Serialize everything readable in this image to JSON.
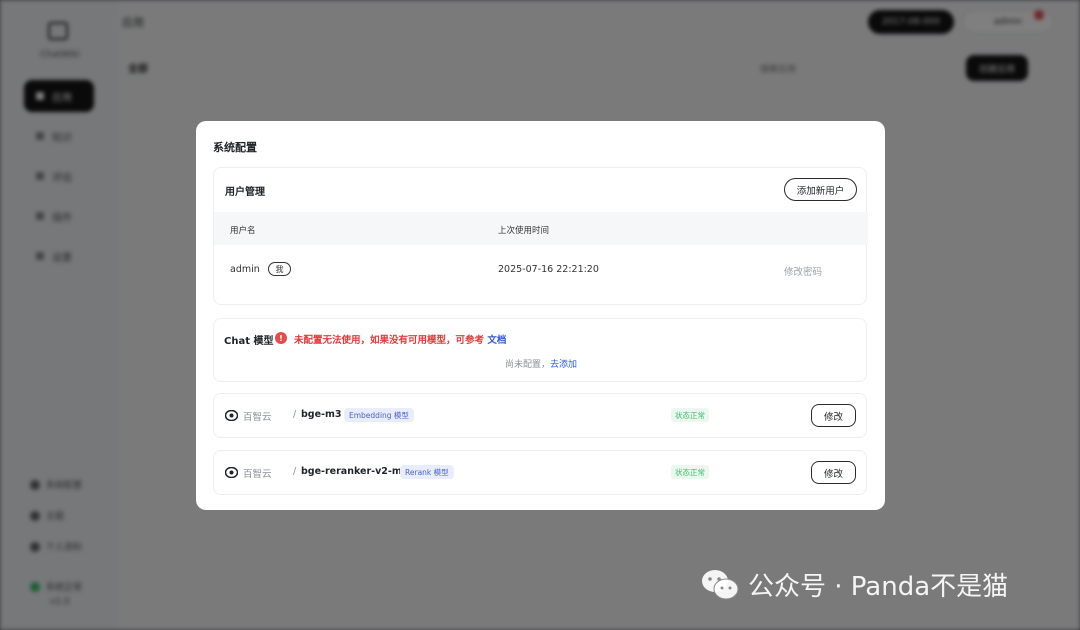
{
  "background": {
    "sidebar": {
      "brand": "ChatWiki",
      "items": [
        {
          "label": "应用",
          "active": true
        },
        {
          "label": "知识",
          "active": false
        },
        {
          "label": "评估",
          "active": false
        },
        {
          "label": "插件",
          "active": false
        },
        {
          "label": "设置",
          "active": false
        }
      ],
      "footer": [
        "系统配置",
        "主题",
        "个人资料",
        "系统正常"
      ],
      "version": "v1.0"
    },
    "header": {
      "title": "应用",
      "primary_button": "2017-08-000",
      "user_button": "admin"
    },
    "toolbar": {
      "section_title": "全部",
      "search_placeholder": "搜索应用",
      "new_button": "创建应用"
    }
  },
  "modal": {
    "title": "系统配置",
    "users": {
      "title": "用户管理",
      "add_button": "添加新用户",
      "columns": [
        "用户名",
        "上次使用时间"
      ],
      "rows": [
        {
          "username": "admin",
          "tag": "我",
          "last_used": "2025-07-16 22:21:20",
          "action": "修改密码"
        }
      ]
    },
    "chat_model": {
      "title": "Chat 模型",
      "warning_icon": "!",
      "warning": "未配置无法使用，如果没有可用模型，可参考",
      "doc_link": "文档",
      "empty_text": "尚未配置，",
      "add_link": "去添加"
    },
    "models": [
      {
        "icon": "eye-icon",
        "provider": "百智云",
        "separator": "/",
        "name": "bge-m3",
        "type": "Embedding 模型",
        "status": "状态正常",
        "edit": "修改"
      },
      {
        "icon": "eye-icon",
        "provider": "百智云",
        "separator": "/",
        "name": "bge-reranker-v2-m3",
        "type": "Rerank 模型",
        "status": "状态正常",
        "edit": "修改"
      }
    ]
  },
  "watermark": {
    "text": "公众号 · Panda不是猫",
    "icon": "wechat-icon"
  },
  "colors": {
    "warning": "#e23c3c",
    "link": "#2f5bd3",
    "status_ok": "#3dbd6b",
    "tag_bg": "#e9edfb",
    "tag_text": "#4b63c9"
  }
}
